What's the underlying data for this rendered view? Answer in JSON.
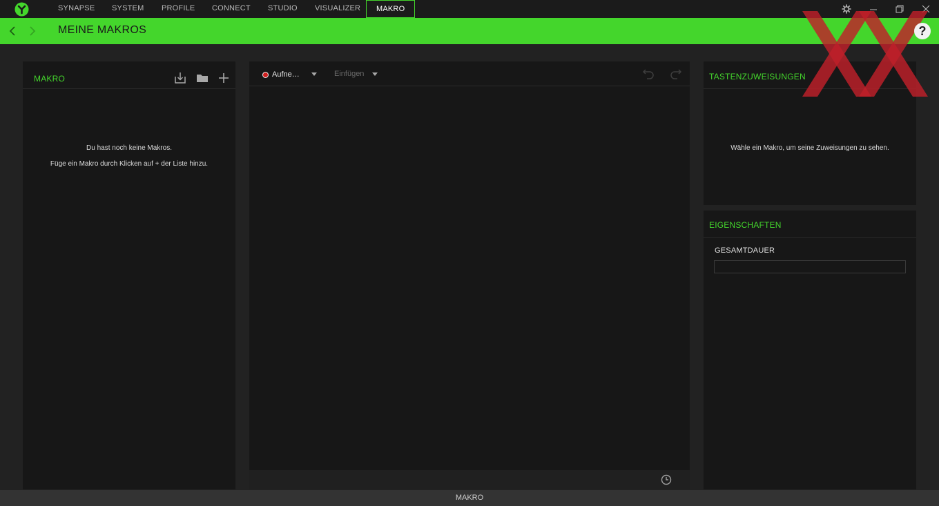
{
  "nav": {
    "tabs": [
      {
        "label": "SYNAPSE"
      },
      {
        "label": "SYSTEM"
      },
      {
        "label": "PROFILE"
      },
      {
        "label": "CONNECT"
      },
      {
        "label": "STUDIO"
      },
      {
        "label": "VISUALIZER"
      },
      {
        "label": "MAKRO",
        "active": true
      }
    ],
    "icons": [
      "razer-logo-icon",
      "settings-gear-icon",
      "minimize-icon",
      "restore-icon",
      "close-icon"
    ]
  },
  "header": {
    "title": "MEINE MAKROS",
    "back_icon": "chevron-left-icon",
    "forward_icon": "chevron-right-icon",
    "help_label": "?"
  },
  "macro_panel": {
    "title": "MAKRO",
    "icons": [
      "import-icon",
      "folder-icon",
      "add-icon"
    ],
    "empty_line1": "Du hast noch keine Makros.",
    "empty_line2": "Füge ein Makro durch Klicken auf + der Liste hinzu."
  },
  "editor": {
    "record_label": "Aufne…",
    "insert_label": "Einfügen",
    "icons": [
      "undo-icon",
      "redo-icon",
      "timer-clock-icon"
    ]
  },
  "assignments_panel": {
    "title": "TASTENZUWEISUNGEN",
    "empty_text": "Wähle ein Makro, um seine Zuweisungen zu sehen."
  },
  "properties_panel": {
    "title": "EIGENSCHAFTEN",
    "duration_label": "GESAMTDAUER",
    "duration_value": ""
  },
  "statusbar": {
    "label": "MAKRO"
  },
  "colors": {
    "accent": "#44d62c",
    "background": "#222222",
    "panel": "#171717",
    "record": "#d02020",
    "watermark": "#c0202a"
  }
}
